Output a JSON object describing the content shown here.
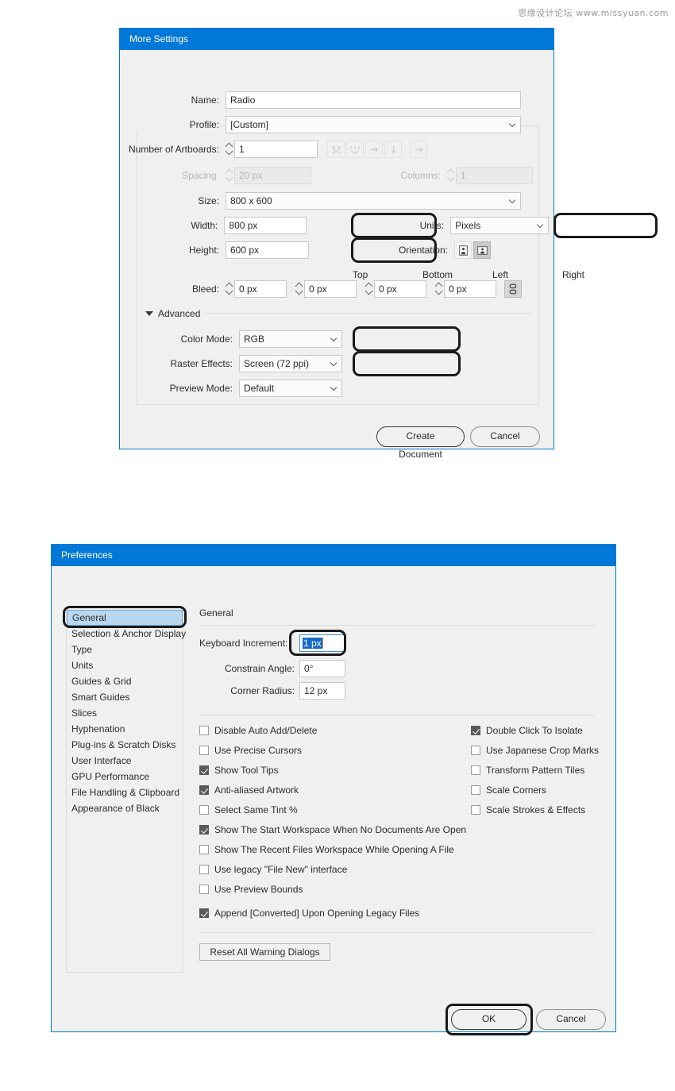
{
  "watermark": "思缘设计论坛  www.missyuan.com",
  "more_settings": {
    "title": "More Settings",
    "fields": {
      "name_label": "Name:",
      "name_value": "Radio",
      "profile_label": "Profile:",
      "profile_value": "[Custom]",
      "artboards_label": "Number of Artboards:",
      "artboards_value": "1",
      "spacing_label": "Spacing:",
      "spacing_value": "20 px",
      "columns_label": "Columns:",
      "columns_value": "1",
      "size_label": "Size:",
      "size_value": "800 x 600",
      "width_label": "Width:",
      "width_value": "800 px",
      "height_label": "Height:",
      "height_value": "600 px",
      "units_label": "Units:",
      "units_value": "Pixels",
      "orientation_label": "Orientation:",
      "bleed_label": "Bleed:",
      "bleed_top_label": "Top",
      "bleed_bottom_label": "Bottom",
      "bleed_left_label": "Left",
      "bleed_right_label": "Right",
      "bleed_top_value": "0 px",
      "bleed_bottom_value": "0 px",
      "bleed_left_value": "0 px",
      "bleed_right_value": "0 px"
    },
    "advanced": {
      "section_label": "Advanced",
      "color_mode_label": "Color Mode:",
      "color_mode_value": "RGB",
      "raster_effects_label": "Raster Effects:",
      "raster_effects_value": "Screen (72 ppi)",
      "preview_mode_label": "Preview Mode:",
      "preview_mode_value": "Default"
    },
    "buttons": {
      "create": "Create Document",
      "cancel": "Cancel"
    }
  },
  "preferences": {
    "title": "Preferences",
    "categories": [
      "General",
      "Selection & Anchor Display",
      "Type",
      "Units",
      "Guides & Grid",
      "Smart Guides",
      "Slices",
      "Hyphenation",
      "Plug-ins & Scratch Disks",
      "User Interface",
      "GPU Performance",
      "File Handling & Clipboard",
      "Appearance of Black"
    ],
    "selected_category": "General",
    "pane_title": "General",
    "fields": {
      "keyboard_increment_label": "Keyboard Increment:",
      "keyboard_increment_value": "1 px",
      "constrain_angle_label": "Constrain Angle:",
      "constrain_angle_value": "0°",
      "corner_radius_label": "Corner Radius:",
      "corner_radius_value": "12 px"
    },
    "checkboxes_left": [
      {
        "label": "Disable Auto Add/Delete",
        "checked": false
      },
      {
        "label": "Use Precise Cursors",
        "checked": false
      },
      {
        "label": "Show Tool Tips",
        "checked": true
      },
      {
        "label": "Anti-aliased Artwork",
        "checked": true
      },
      {
        "label": "Select Same Tint %",
        "checked": false
      },
      {
        "label": "Show The Start Workspace When No Documents Are Open",
        "checked": true
      },
      {
        "label": "Show The Recent Files Workspace While Opening A File",
        "checked": false
      },
      {
        "label": "Use legacy \"File New\" interface",
        "checked": false
      },
      {
        "label": "Use Preview Bounds",
        "checked": false
      },
      {
        "label": "Append [Converted] Upon Opening Legacy Files",
        "checked": true
      }
    ],
    "checkboxes_right": [
      {
        "label": "Double Click To Isolate",
        "checked": true
      },
      {
        "label": "Use Japanese Crop Marks",
        "checked": false
      },
      {
        "label": "Transform Pattern Tiles",
        "checked": false
      },
      {
        "label": "Scale Corners",
        "checked": false
      },
      {
        "label": "Scale Strokes & Effects",
        "checked": false
      }
    ],
    "reset_button": "Reset All Warning Dialogs",
    "buttons": {
      "ok": "OK",
      "cancel": "Cancel"
    }
  },
  "colors": {
    "titlebar_blue": "#0078d7",
    "dialog_bg": "#f0f0f0",
    "selection_blue": "#b8d7f0",
    "text_selection": "#1669c8",
    "highlight_ring": "#1a1a1a"
  }
}
